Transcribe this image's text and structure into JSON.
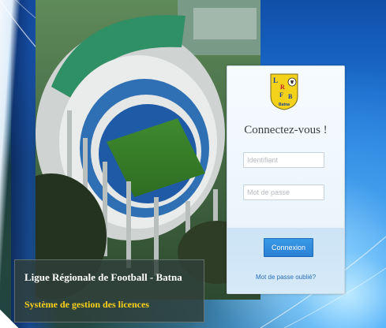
{
  "login": {
    "title": "Connectez-vous !",
    "username_placeholder": "Identifiant",
    "password_placeholder": "Mot de passe",
    "submit_label": "Connexion",
    "forgot_label": "Mot de passe oublié?"
  },
  "logo": {
    "letters": [
      "L",
      "R",
      "F",
      "B"
    ],
    "caption": "Batna"
  },
  "banner": {
    "title": "Ligue Régionale de Football - Batna",
    "subtitle": "Système de gestion des licences"
  },
  "colors": {
    "accent": "#2a7fd4",
    "banner_subtitle": "#ffd21a",
    "logo_fill": "#f4d21c"
  }
}
